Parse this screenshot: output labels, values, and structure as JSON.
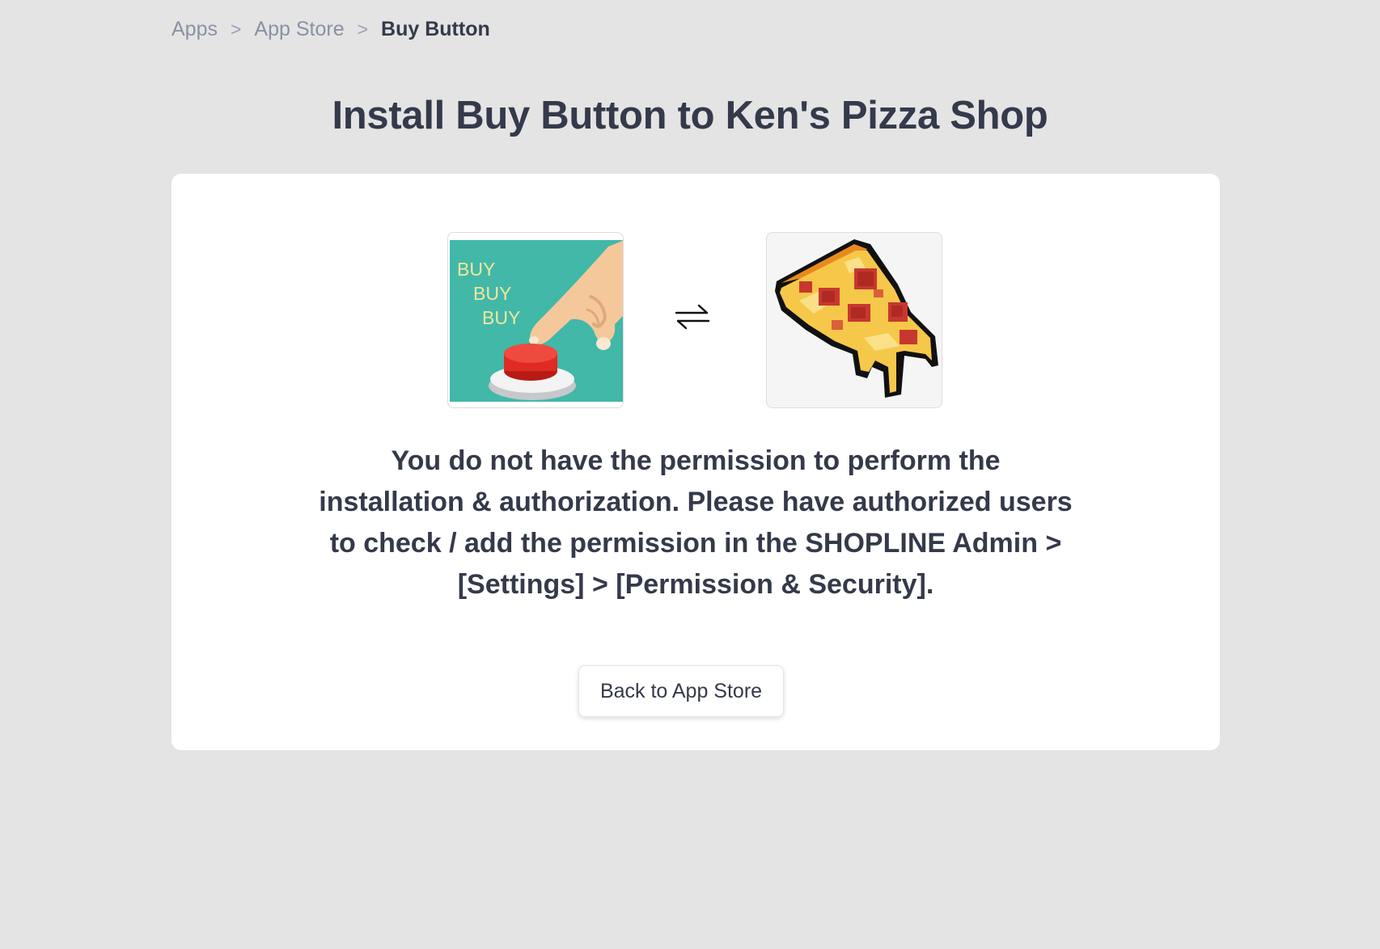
{
  "breadcrumb": {
    "items": [
      "Apps",
      "App Store"
    ],
    "separator": ">",
    "current": "Buy Button"
  },
  "page": {
    "title": "Install Buy Button to Ken's Pizza Shop"
  },
  "install": {
    "app_icon_text": [
      "BUY",
      "BUY",
      "BUY"
    ],
    "swap_icon": "swap-arrows-icon",
    "shop_icon": "pizza-slice-icon",
    "message": "You do not have the permission to perform the installation & authorization. Please have authorized users to check / add the permission in the SHOPLINE Admin > [Settings] > [Permission & Security].",
    "back_button_label": "Back to App Store"
  },
  "colors": {
    "background": "#e4e4e5",
    "card": "#ffffff",
    "text": "#353a4a",
    "muted": "#8a91a2",
    "app_icon_bg": "#42b8a9",
    "app_icon_text": "#f4e69a",
    "button_red": "#e02a23"
  }
}
